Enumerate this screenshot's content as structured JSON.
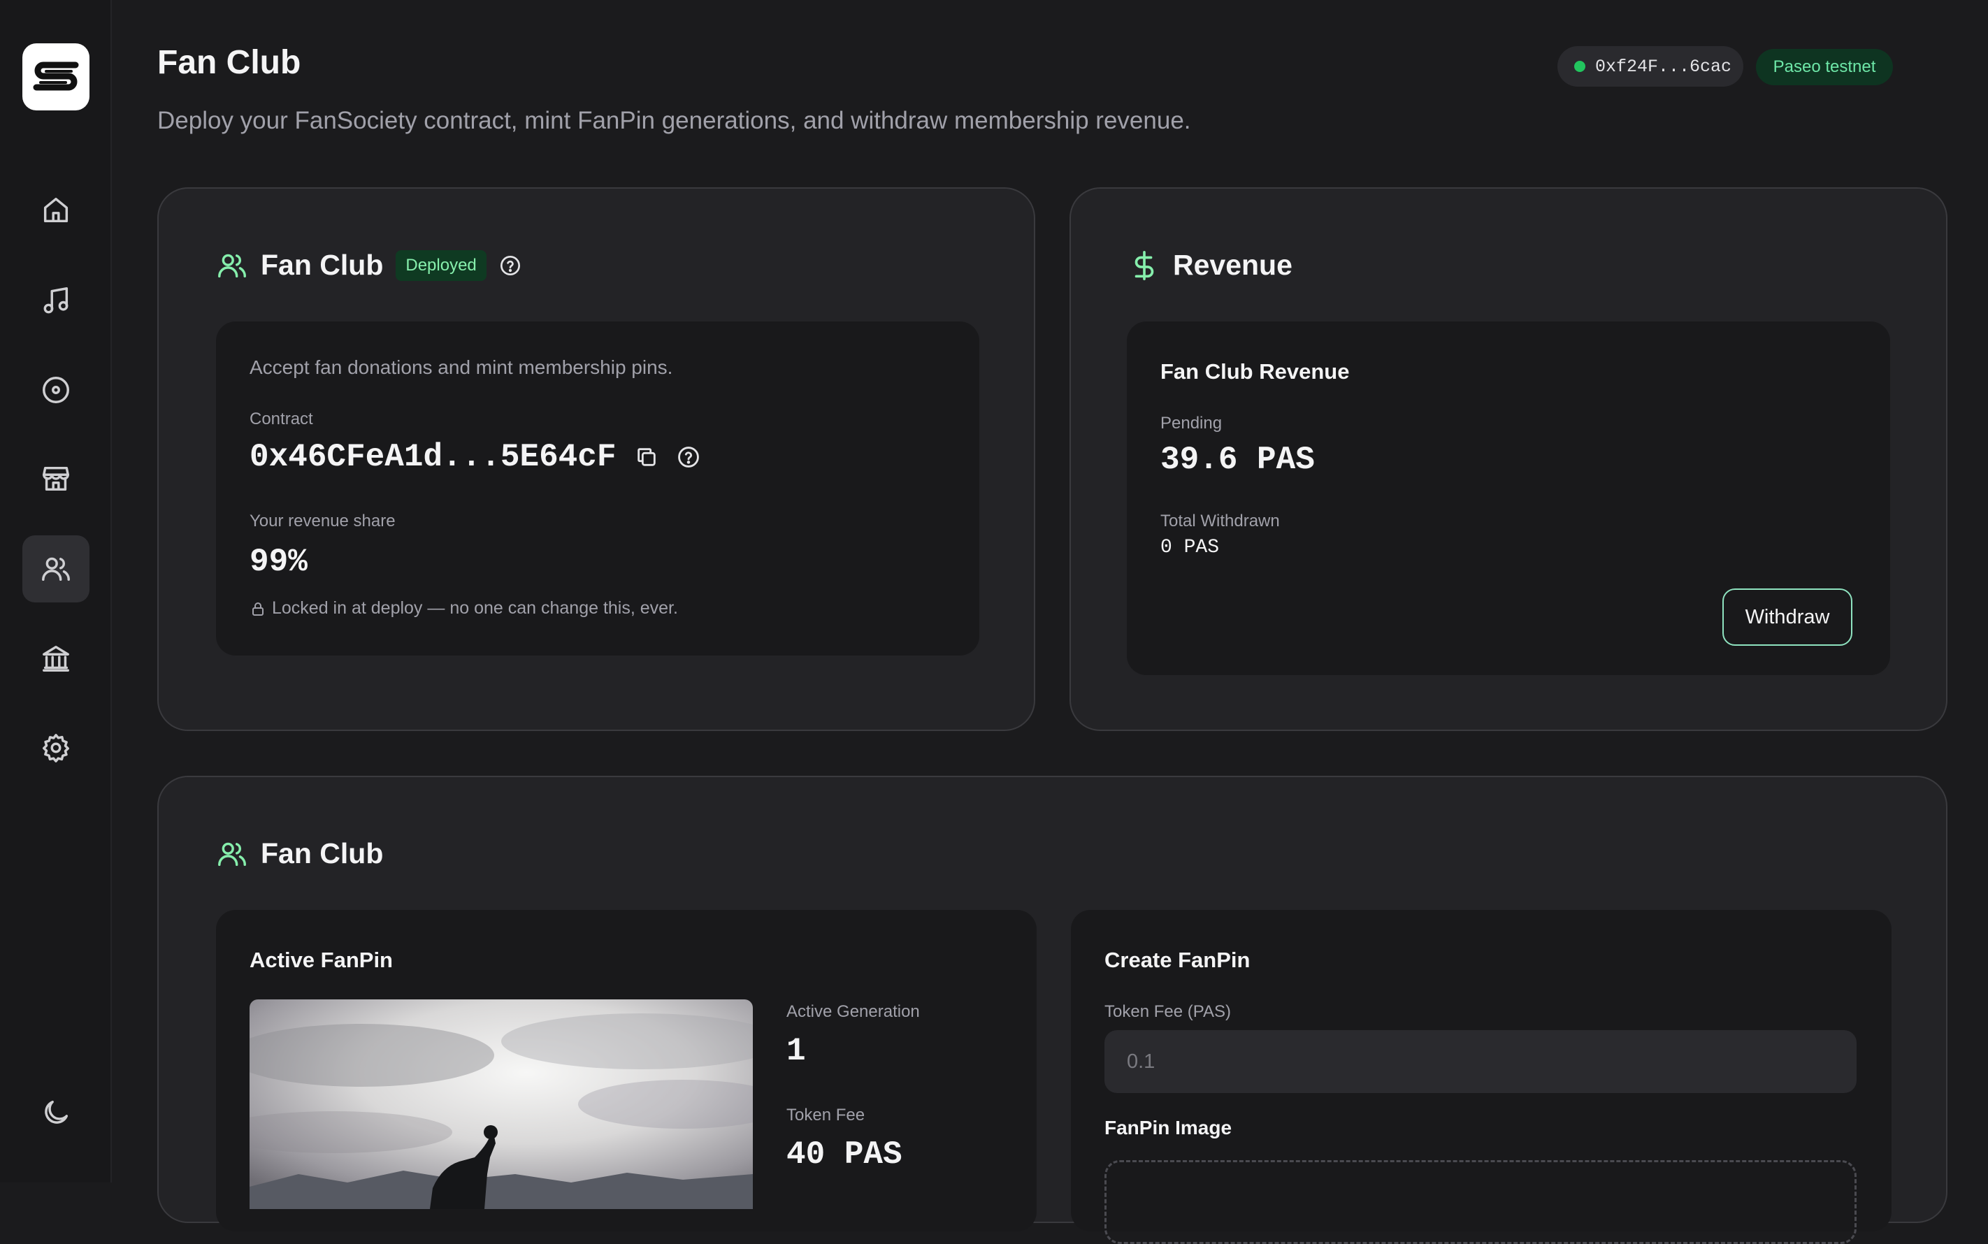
{
  "header": {
    "title": "Fan Club",
    "subtitle": "Deploy your FanSociety contract, mint FanPin generations, and withdraw membership revenue.",
    "wallet_address": "0xf24F...6cac",
    "network": "Paseo testnet"
  },
  "sidebar": {
    "items": [
      {
        "icon": "home-icon"
      },
      {
        "icon": "music-note-icon"
      },
      {
        "icon": "disc-icon"
      },
      {
        "icon": "store-icon"
      },
      {
        "icon": "users-icon",
        "active": true
      },
      {
        "icon": "bank-icon"
      },
      {
        "icon": "gear-icon"
      }
    ],
    "theme_toggle_icon": "moon-icon"
  },
  "fan_club_card": {
    "title": "Fan Club",
    "badge": "Deployed",
    "description": "Accept fan donations and mint membership pins.",
    "contract_label": "Contract",
    "contract_address": "0x46CFeA1d...5E64cF",
    "revenue_share_label": "Your revenue share",
    "revenue_share": "99%",
    "lock_note": "Locked in at deploy — no one can change this, ever."
  },
  "revenue_card": {
    "title": "Revenue",
    "panel_title": "Fan Club Revenue",
    "pending_label": "Pending",
    "pending_value": "39.6 PAS",
    "withdrawn_label": "Total Withdrawn",
    "withdrawn_value": "0 PAS",
    "withdraw_button": "Withdraw"
  },
  "fanpin_section": {
    "title": "Fan Club",
    "active": {
      "title": "Active FanPin",
      "generation_label": "Active Generation",
      "generation_value": "1",
      "fee_label": "Token Fee",
      "fee_value": "40 PAS"
    },
    "create": {
      "title": "Create FanPin",
      "fee_label": "Token Fee (PAS)",
      "fee_placeholder": "0.1",
      "image_label": "FanPin Image"
    }
  },
  "colors": {
    "background": "#1b1b1d",
    "card": "#232326",
    "accent_green": "#86efac",
    "status_dot": "#22c55e"
  }
}
